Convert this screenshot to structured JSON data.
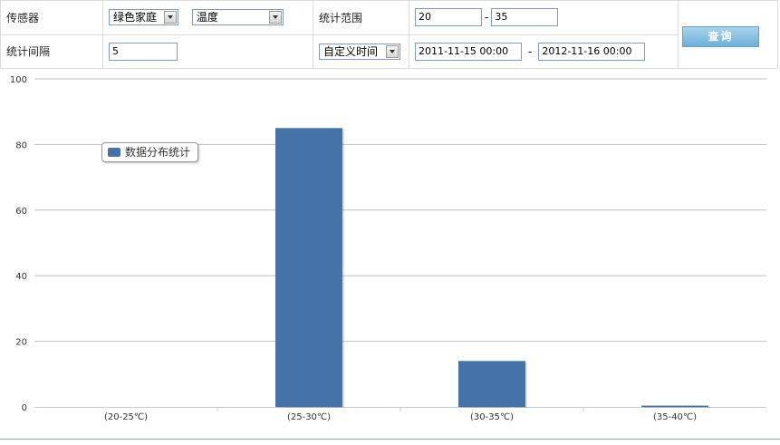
{
  "form": {
    "sensor_label": "传感器",
    "sensor_group": "绿色家庭",
    "sensor_type": "温度",
    "range_label": "统计范围",
    "range_min": "20",
    "range_max": "35",
    "range_sep": "-",
    "interval_label": "统计间隔",
    "interval_value": "5",
    "time_mode": "自定义时间",
    "time_start": "2011-11-15 00:00",
    "time_end": "2012-11-16 00:00",
    "time_sep": "-",
    "query_label": "查询"
  },
  "colors": {
    "bar": "#4572a7",
    "grid": "#c0c0c0",
    "axis_text": "#333333"
  },
  "chart_data": {
    "type": "bar",
    "categories": [
      "(20-25℃)",
      "(25-30℃)",
      "(30-35℃)",
      "(35-40℃)"
    ],
    "series": [
      {
        "name": "数据分布统计",
        "values": [
          0,
          85,
          14,
          0.4
        ]
      }
    ],
    "ylim": [
      0,
      100
    ],
    "yticks": [
      0,
      20,
      40,
      60,
      80,
      100
    ],
    "grid": true,
    "legend_position": "top-left"
  }
}
